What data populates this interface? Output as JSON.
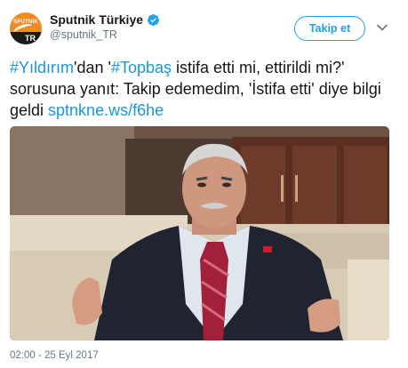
{
  "account": {
    "display_name": "Sputnik Türkiye",
    "handle": "@sputnik_TR",
    "verified": true,
    "avatar_label": "SPUTNIK",
    "avatar_badge": "TR"
  },
  "actions": {
    "follow_label": "Takip et",
    "menu_icon": "chevron-down-icon"
  },
  "tweet": {
    "segments": [
      {
        "text": "#Yıldırım",
        "type": "hashtag"
      },
      {
        "text": "'dan '",
        "type": "text"
      },
      {
        "text": "#Topbaş",
        "type": "hashtag"
      },
      {
        "text": " istifa etti mi, ettirildi mi?' sorusuna yanıt: Takip edemedim, 'İstifa etti' diye bilgi geldi ",
        "type": "text"
      },
      {
        "text": "sptnkne.ws/f6he",
        "type": "link"
      }
    ]
  },
  "media": {
    "description_icon": "photo"
  },
  "timestamp": "02:00 - 25 Eyl 2017",
  "colors": {
    "link": "#1b95e0",
    "accent": "#1da1f2",
    "avatar_bg": "#f08a24",
    "muted": "#657786"
  }
}
